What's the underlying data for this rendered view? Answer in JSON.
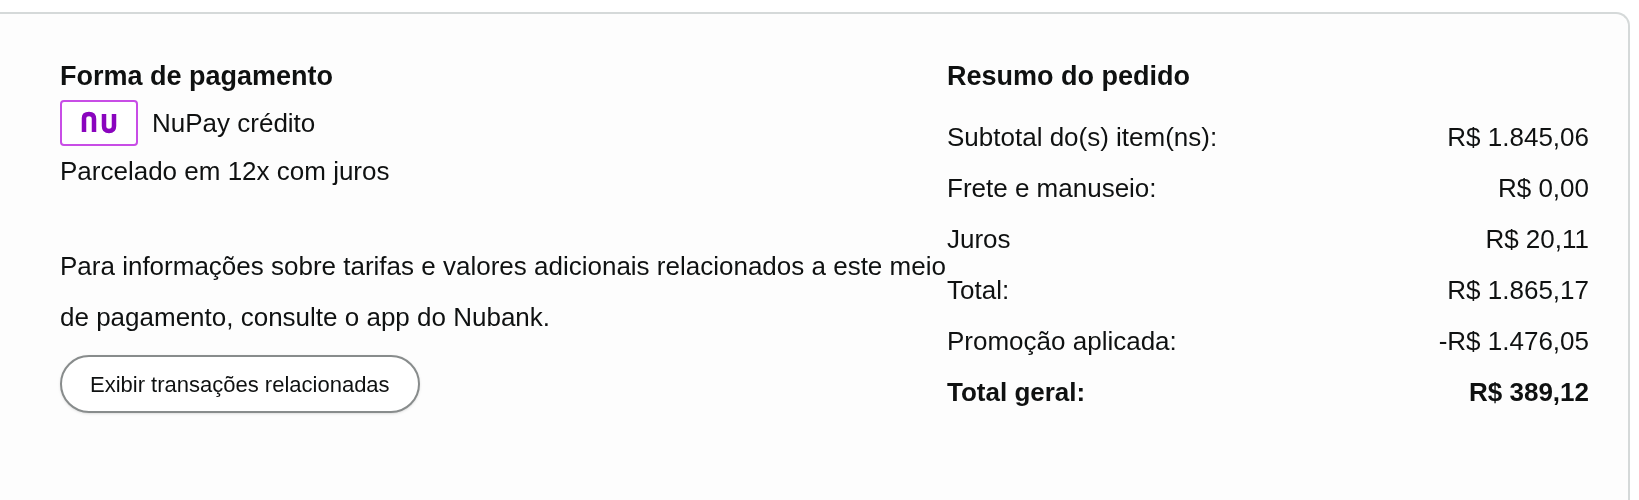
{
  "payment": {
    "title": "Forma de pagamento",
    "method": "NuPay crédito",
    "installments": "Parcelado em 12x com juros",
    "info": "Para informações sobre tarifas e valores adicionais relacionados a este meio de pagamento, consulte o app do Nubank.",
    "button": "Exibir transações relacionadas"
  },
  "summary": {
    "title": "Resumo do pedido",
    "rows": [
      {
        "kind": "line",
        "label": "Subtotal do(s) item(ns):",
        "value": "R$ 1.845,06"
      },
      {
        "kind": "line",
        "label": "Frete e manuseio:",
        "value": "R$ 0,00"
      },
      {
        "kind": "line",
        "label": "Juros",
        "value": "R$ 20,11"
      },
      {
        "kind": "line",
        "label": "Total:",
        "value": "R$ 1.865,17"
      },
      {
        "kind": "line",
        "label": "Promoção aplicada:",
        "value": "-R$ 1.476,05"
      },
      {
        "kind": "grand_total",
        "label": "Total geral:",
        "value": "R$ 389,12"
      }
    ]
  }
}
